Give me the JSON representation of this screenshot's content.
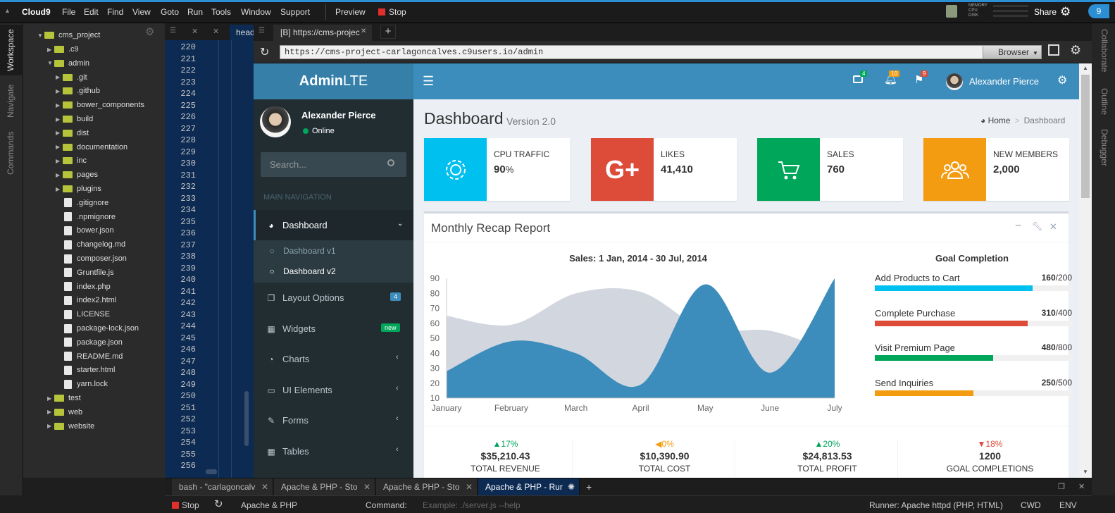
{
  "menubar": {
    "brand": "Cloud9",
    "items": [
      "File",
      "Edit",
      "Find",
      "View",
      "Goto",
      "Run",
      "Tools",
      "Window",
      "Support"
    ],
    "preview": "Preview",
    "stop": "Stop",
    "metrics": [
      "MEMORY",
      "CPU",
      "DISK"
    ],
    "share": "Share"
  },
  "left_tabs": [
    "Workspace",
    "Navigate",
    "Commands"
  ],
  "right_tabs": [
    "Collaborate",
    "Outline",
    "Debugger"
  ],
  "tree": {
    "root": "cms_project",
    "items": [
      {
        "label": ".c9",
        "type": "folder",
        "depth": 1,
        "open": false
      },
      {
        "label": "admin",
        "type": "folder",
        "depth": 1,
        "open": true
      },
      {
        "label": ".git",
        "type": "folder",
        "depth": 2,
        "open": false
      },
      {
        "label": ".github",
        "type": "folder",
        "depth": 2,
        "open": false
      },
      {
        "label": "bower_components",
        "type": "folder",
        "depth": 2,
        "open": false
      },
      {
        "label": "build",
        "type": "folder",
        "depth": 2,
        "open": false
      },
      {
        "label": "dist",
        "type": "folder",
        "depth": 2,
        "open": false
      },
      {
        "label": "documentation",
        "type": "folder",
        "depth": 2,
        "open": false
      },
      {
        "label": "inc",
        "type": "folder",
        "depth": 2,
        "open": false
      },
      {
        "label": "pages",
        "type": "folder",
        "depth": 2,
        "open": false
      },
      {
        "label": "plugins",
        "type": "folder",
        "depth": 2,
        "open": false
      },
      {
        "label": ".gitignore",
        "type": "file",
        "depth": 2
      },
      {
        "label": ".npmignore",
        "type": "file",
        "depth": 2
      },
      {
        "label": "bower.json",
        "type": "file",
        "depth": 2
      },
      {
        "label": "changelog.md",
        "type": "file",
        "depth": 2
      },
      {
        "label": "composer.json",
        "type": "file",
        "depth": 2
      },
      {
        "label": "Gruntfile.js",
        "type": "file",
        "depth": 2
      },
      {
        "label": "index.php",
        "type": "file",
        "depth": 2
      },
      {
        "label": "index2.html",
        "type": "file",
        "depth": 2
      },
      {
        "label": "LICENSE",
        "type": "file",
        "depth": 2
      },
      {
        "label": "package-lock.json",
        "type": "file",
        "depth": 2
      },
      {
        "label": "package.json",
        "type": "file",
        "depth": 2
      },
      {
        "label": "README.md",
        "type": "file",
        "depth": 2
      },
      {
        "label": "starter.html",
        "type": "file",
        "depth": 2
      },
      {
        "label": "yarn.lock",
        "type": "file",
        "depth": 2
      },
      {
        "label": "test",
        "type": "folder",
        "depth": 1,
        "open": false
      },
      {
        "label": "web",
        "type": "folder",
        "depth": 1,
        "open": false
      },
      {
        "label": "website",
        "type": "folder",
        "depth": 1,
        "open": false
      }
    ]
  },
  "editor": {
    "tab": "head",
    "lines": [
      "220",
      "221",
      "222",
      "223",
      "224",
      "225",
      "226",
      "227",
      "228",
      "229",
      "230",
      "231",
      "232",
      "233",
      "234",
      "235",
      "236",
      "237",
      "238",
      "239",
      "240",
      "241",
      "242",
      "243",
      "244",
      "245",
      "246",
      "247",
      "248",
      "249",
      "250",
      "251",
      "252",
      "253",
      "254",
      "255",
      "256"
    ]
  },
  "browser": {
    "tab": "[B] https://cms-projec",
    "url": "https://cms-project-carlagoncalves.c9users.io/admin",
    "browser_label": "Browser"
  },
  "adminlte": {
    "logo_bold": "Admin",
    "logo_light": "LTE",
    "badges": {
      "mail": "4",
      "bell": "10",
      "flag": "9"
    },
    "user": "Alexander Pierce",
    "status": "Online",
    "search_placeholder": "Search...",
    "nav_header": "MAIN NAVIGATION",
    "nav": [
      {
        "label": "Dashboard",
        "icon": "dashboard-icon"
      },
      {
        "label": "Dashboard v1",
        "icon": "circle-icon"
      },
      {
        "label": "Dashboard v2",
        "icon": "circle-icon"
      },
      {
        "label": "Layout Options",
        "icon": "files-icon",
        "badge": "4"
      },
      {
        "label": "Widgets",
        "icon": "grid-icon",
        "badge": "new"
      },
      {
        "label": "Charts",
        "icon": "pie-chart-icon"
      },
      {
        "label": "UI Elements",
        "icon": "laptop-icon"
      },
      {
        "label": "Forms",
        "icon": "edit-icon"
      },
      {
        "label": "Tables",
        "icon": "table-icon"
      }
    ],
    "page_title": "Dashboard",
    "page_subtitle": "Version 2.0",
    "breadcrumb": [
      "Home",
      "Dashboard"
    ],
    "info_boxes": [
      {
        "label": "CPU TRAFFIC",
        "value": "90",
        "unit": "%",
        "color": "#00c0ef",
        "icon": "gear-icon"
      },
      {
        "label": "LIKES",
        "value": "41,410",
        "unit": "",
        "color": "#dd4b39",
        "icon": "google-plus-icon"
      },
      {
        "label": "SALES",
        "value": "760",
        "unit": "",
        "color": "#00a65a",
        "icon": "cart-icon"
      },
      {
        "label": "NEW MEMBERS",
        "value": "2,000",
        "unit": "",
        "color": "#f39c12",
        "icon": "users-icon"
      }
    ],
    "recap": {
      "title": "Monthly Recap Report",
      "goal_title": "Goal Completion",
      "goals": [
        {
          "label": "Add Products to Cart",
          "done": "160",
          "total": "/200",
          "pct": 0.8,
          "color": "#00c0ef"
        },
        {
          "label": "Complete Purchase",
          "done": "310",
          "total": "/400",
          "pct": 0.775,
          "color": "#dd4b39"
        },
        {
          "label": "Visit Premium Page",
          "done": "480",
          "total": "/800",
          "pct": 0.6,
          "color": "#00a65a"
        },
        {
          "label": "Send Inquiries",
          "done": "250",
          "total": "/500",
          "pct": 0.5,
          "color": "#f39c12"
        }
      ],
      "stats": [
        {
          "pct": "17%",
          "value": "$35,210.43",
          "label": "TOTAL REVENUE",
          "color": "#00a65a",
          "dir": "up"
        },
        {
          "pct": "0%",
          "value": "$10,390.90",
          "label": "TOTAL COST",
          "color": "#f39c12",
          "dir": "left"
        },
        {
          "pct": "20%",
          "value": "$24,813.53",
          "label": "TOTAL PROFIT",
          "color": "#00a65a",
          "dir": "up"
        },
        {
          "pct": "18%",
          "value": "1200",
          "label": "GOAL COMPLETIONS",
          "color": "#dd4b39",
          "dir": "down"
        }
      ]
    }
  },
  "chart_data": {
    "type": "area",
    "title": "Sales: 1 Jan, 2014 - 30 Jul, 2014",
    "categories": [
      "January",
      "February",
      "March",
      "April",
      "May",
      "June",
      "July"
    ],
    "ylim": [
      10,
      90
    ],
    "yticks": [
      10,
      20,
      30,
      40,
      50,
      60,
      70,
      80,
      90
    ],
    "series": [
      {
        "values": [
          65,
          59,
          80,
          81,
          56,
          55,
          40
        ],
        "color": "#d2d6de"
      },
      {
        "values": [
          28,
          48,
          40,
          19,
          86,
          27,
          90
        ],
        "color": "#3c8dbc"
      }
    ],
    "grid": false
  },
  "terminal": {
    "tabs": [
      "bash - \"carlagoncalv",
      "Apache & PHP - Sto",
      "Apache & PHP - Sto",
      "Apache & PHP - Rur"
    ],
    "stop": "Stop",
    "runner_name": "Apache & PHP",
    "command_label": "Command:",
    "command_placeholder": "Example: ./server.js --help",
    "runner": "Runner: Apache httpd (PHP, HTML)",
    "cwd": "CWD",
    "env": "ENV"
  }
}
